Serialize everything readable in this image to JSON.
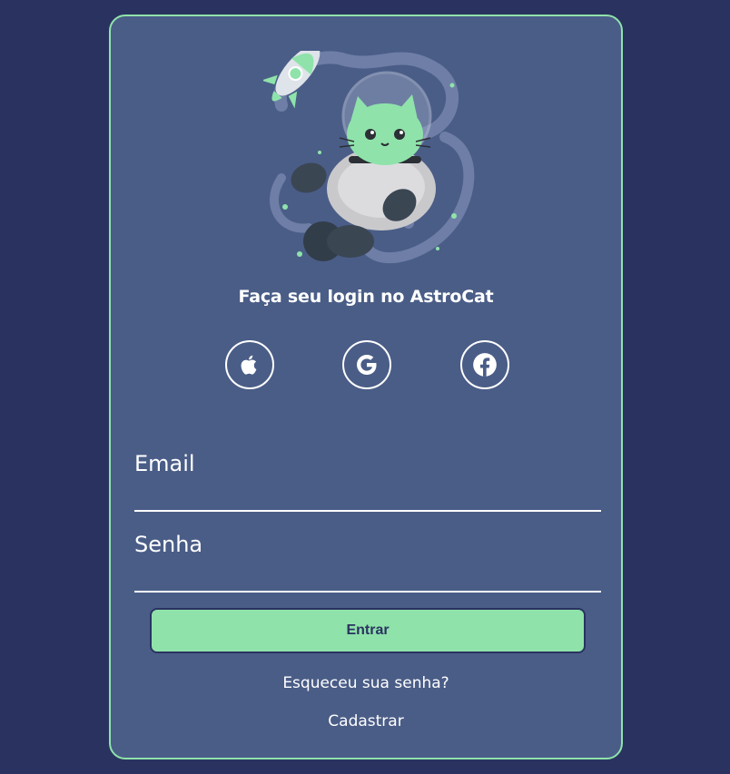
{
  "colors": {
    "page_background": "#2a3360",
    "card_background": "#4a5d87",
    "card_border": "#8fe3aa",
    "accent": "#8fe3aa",
    "text": "#ffffff"
  },
  "header": {
    "title": "Faça seu login no AstroCat",
    "illustration_icon": "astronaut-cat-icon"
  },
  "social_login": [
    {
      "icon": "apple-icon"
    },
    {
      "icon": "google-icon"
    },
    {
      "icon": "facebook-icon"
    }
  ],
  "form": {
    "email_label": "Email",
    "email_value": "",
    "password_label": "Senha",
    "password_value": "",
    "submit_label": "Entrar"
  },
  "links": {
    "forgot_password": "Esqueceu sua senha?",
    "register": "Cadastrar"
  }
}
